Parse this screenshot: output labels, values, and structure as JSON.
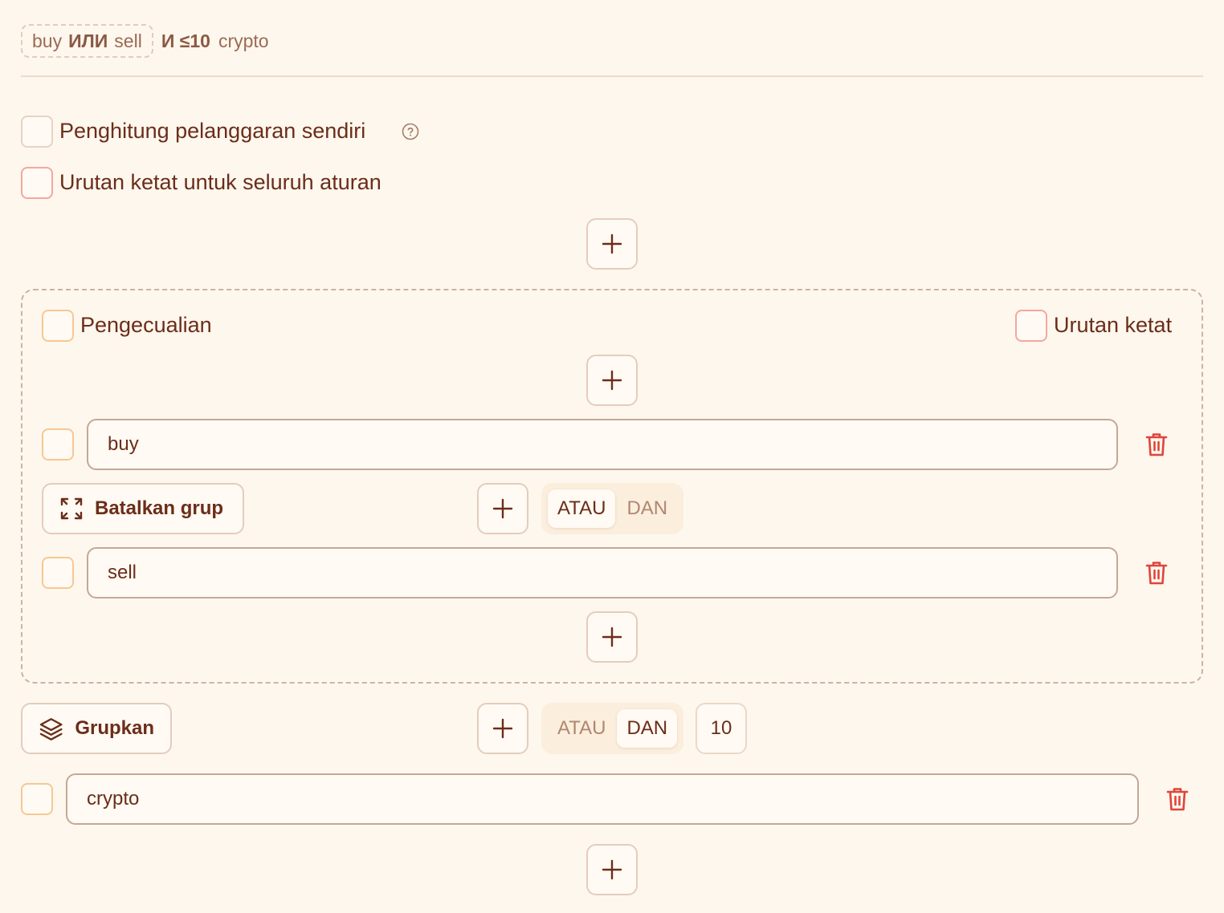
{
  "summary": {
    "group_term_1": "buy",
    "group_op": "ИЛИ",
    "group_term_2": "sell",
    "and_op": "И",
    "limit": "≤10",
    "term": "crypto"
  },
  "options": {
    "custom_counter_label": "Penghitung pelanggaran sendiri",
    "strict_order_all_label": "Urutan ketat untuk seluruh aturan"
  },
  "group": {
    "exclusion_label": "Pengecualian",
    "strict_order_label": "Urutan ketat",
    "rows": [
      {
        "value": "buy"
      },
      {
        "value": "sell"
      }
    ],
    "ungroup_label": "Batalkan grup",
    "toggle": {
      "or": "ATAU",
      "and": "DAN",
      "selected": "ATAU"
    }
  },
  "outer": {
    "group_button_label": "Grupkan",
    "toggle": {
      "or": "ATAU",
      "and": "DAN",
      "selected": "DAN"
    },
    "limit_value": "10",
    "row": {
      "value": "crypto"
    }
  },
  "icons": {
    "help": "question-circle-icon",
    "plus": "plus-icon",
    "trash": "trash-icon",
    "collapse": "collapse-arrows-icon",
    "layers": "layers-icon"
  },
  "colors": {
    "background": "#fef7ed",
    "text": "#6b2d1a",
    "danger": "#e0443c",
    "checkbox_orange": "#f6c893",
    "checkbox_pink": "#f4a7a0"
  }
}
